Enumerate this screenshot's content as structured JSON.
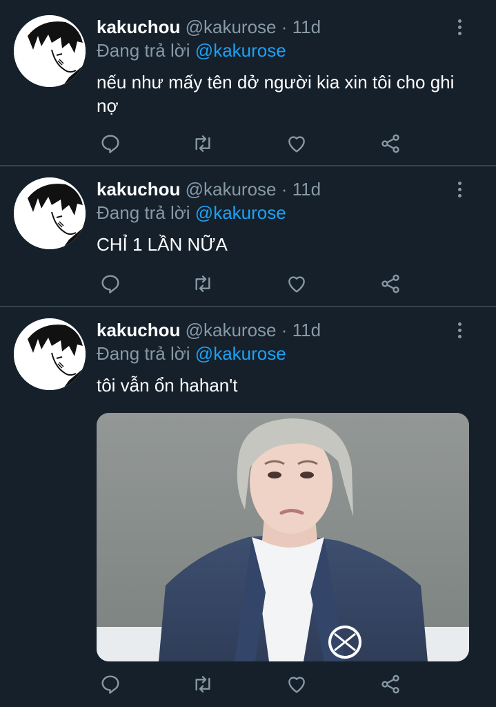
{
  "tweets": [
    {
      "name": "kakuchou",
      "handle": "@kakurose",
      "dot": "·",
      "time": "11d",
      "replying_prefix": "Đang trả lời",
      "replying_to": "@kakurose",
      "text": "nếu như mấy tên dở người kia xin tôi cho ghi nợ"
    },
    {
      "name": "kakuchou",
      "handle": "@kakurose",
      "dot": "·",
      "time": "11d",
      "replying_prefix": "Đang trả lời",
      "replying_to": "@kakurose",
      "text": "CHỈ 1 LẦN NỮA"
    },
    {
      "name": "kakuchou",
      "handle": "@kakurose",
      "dot": "·",
      "time": "11d",
      "replying_prefix": "Đang trả lời",
      "replying_to": "@kakurose",
      "text": "tôi vẫn ổn hahan't",
      "media": "photo of a person in a navy blazer with a pouting expression"
    }
  ],
  "icons": {
    "reply": "reply-icon",
    "retweet": "retweet-icon",
    "like": "heart-icon",
    "share": "share-icon",
    "more": "more-options-icon"
  },
  "colors": {
    "background": "#15202b",
    "divider": "#38444d",
    "secondary_text": "#8899a6",
    "mention": "#1da1f2"
  }
}
